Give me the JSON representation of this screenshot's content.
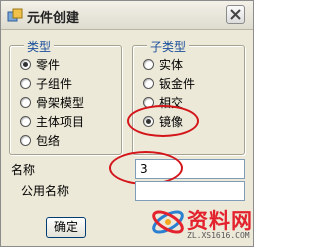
{
  "window": {
    "title": "元件创建"
  },
  "type_group": {
    "title": "类型",
    "options": [
      {
        "label": "零件",
        "checked": true
      },
      {
        "label": "子组件",
        "checked": false
      },
      {
        "label": "骨架模型",
        "checked": false
      },
      {
        "label": "主体项目",
        "checked": false
      },
      {
        "label": "包络",
        "checked": false
      }
    ]
  },
  "subtype_group": {
    "title": "子类型",
    "options": [
      {
        "label": "实体",
        "checked": false
      },
      {
        "label": "钣金件",
        "checked": false
      },
      {
        "label": "相交",
        "checked": false
      },
      {
        "label": "镜像",
        "checked": true
      }
    ]
  },
  "name_field": {
    "label": "名称",
    "value": "3"
  },
  "common_name_field": {
    "label": "公用名称",
    "value": ""
  },
  "buttons": {
    "ok_label": "确定"
  },
  "watermark": {
    "text": "资料网",
    "url": "ZL.XS1616.COM"
  }
}
